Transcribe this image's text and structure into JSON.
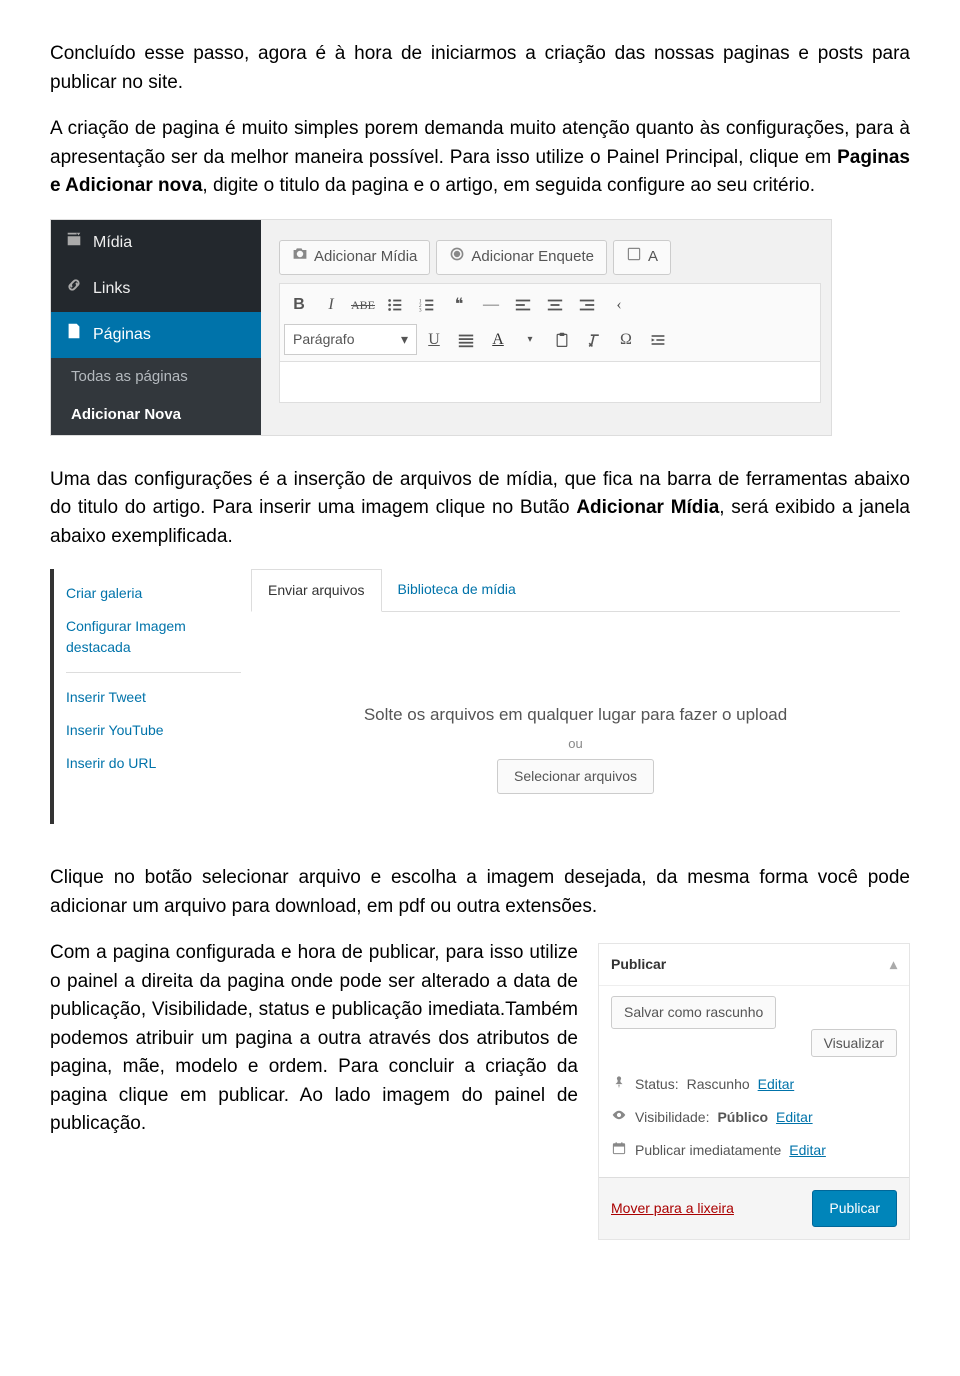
{
  "paragraphs": {
    "p1": "Concluído esse passo, agora é à hora de iniciarmos a criação das nossas paginas e posts para publicar no site.",
    "p2a": "A criação de pagina é muito simples porem demanda muito atenção quanto às configurações, para à apresentação ser da melhor maneira possível. Para isso utilize o Painel Principal, clique em ",
    "p2b": "Paginas e Adicionar nova",
    "p2c": ", digite o titulo da pagina e o artigo, em seguida configure ao seu critério.",
    "p3a": "Uma das configurações é a inserção de arquivos de mídia, que fica na barra de ferramentas abaixo do titulo do artigo. Para inserir uma imagem clique no Butão ",
    "p3b": "Adicionar Mídia",
    "p3c": ", será exibido a janela abaixo exemplificada.",
    "p4": "Clique no botão selecionar arquivo e escolha a imagem desejada, da mesma forma você pode adicionar um arquivo para download, em pdf ou outra extensões.",
    "p5": "Com a pagina configurada e hora de publicar, para isso utilize o painel a direita da pagina onde pode ser alterado a data de publicação, Visibilidade, status e publicação imediata.Também podemos atribuir um pagina a outra através dos atributos de pagina, mãe, modelo e ordem. Para concluir a criação da pagina clique em publicar. Ao lado imagem do painel de publicação."
  },
  "wp": {
    "sidebar": {
      "midia": "Mídia",
      "links": "Links",
      "paginas": "Páginas",
      "todas": "Todas as páginas",
      "adicionar": "Adicionar Nova"
    },
    "editor": {
      "add_media": "Adicionar Mídia",
      "add_poll": "Adicionar Enquete",
      "extra_btn": "A",
      "format_select": "Parágrafo"
    }
  },
  "media": {
    "left": {
      "criar_galeria": "Criar galeria",
      "config_imagem": "Configurar Imagem destacada",
      "inserir_tweet": "Inserir Tweet",
      "inserir_youtube": "Inserir YouTube",
      "inserir_url": "Inserir do URL"
    },
    "tabs": {
      "enviar": "Enviar arquivos",
      "biblioteca": "Biblioteca de mídia"
    },
    "drop": {
      "msg": "Solte os arquivos em qualquer lugar para fazer o upload",
      "ou": "ou",
      "select": "Selecionar arquivos"
    }
  },
  "publish": {
    "title": "Publicar",
    "save_draft": "Salvar como rascunho",
    "preview": "Visualizar",
    "status_label": "Status:",
    "status_value": "Rascunho",
    "visibility_label": "Visibilidade:",
    "visibility_value": "Público",
    "schedule": "Publicar imediatamente",
    "edit_link": "Editar",
    "trash": "Mover para a lixeira",
    "publish_btn": "Publicar"
  }
}
